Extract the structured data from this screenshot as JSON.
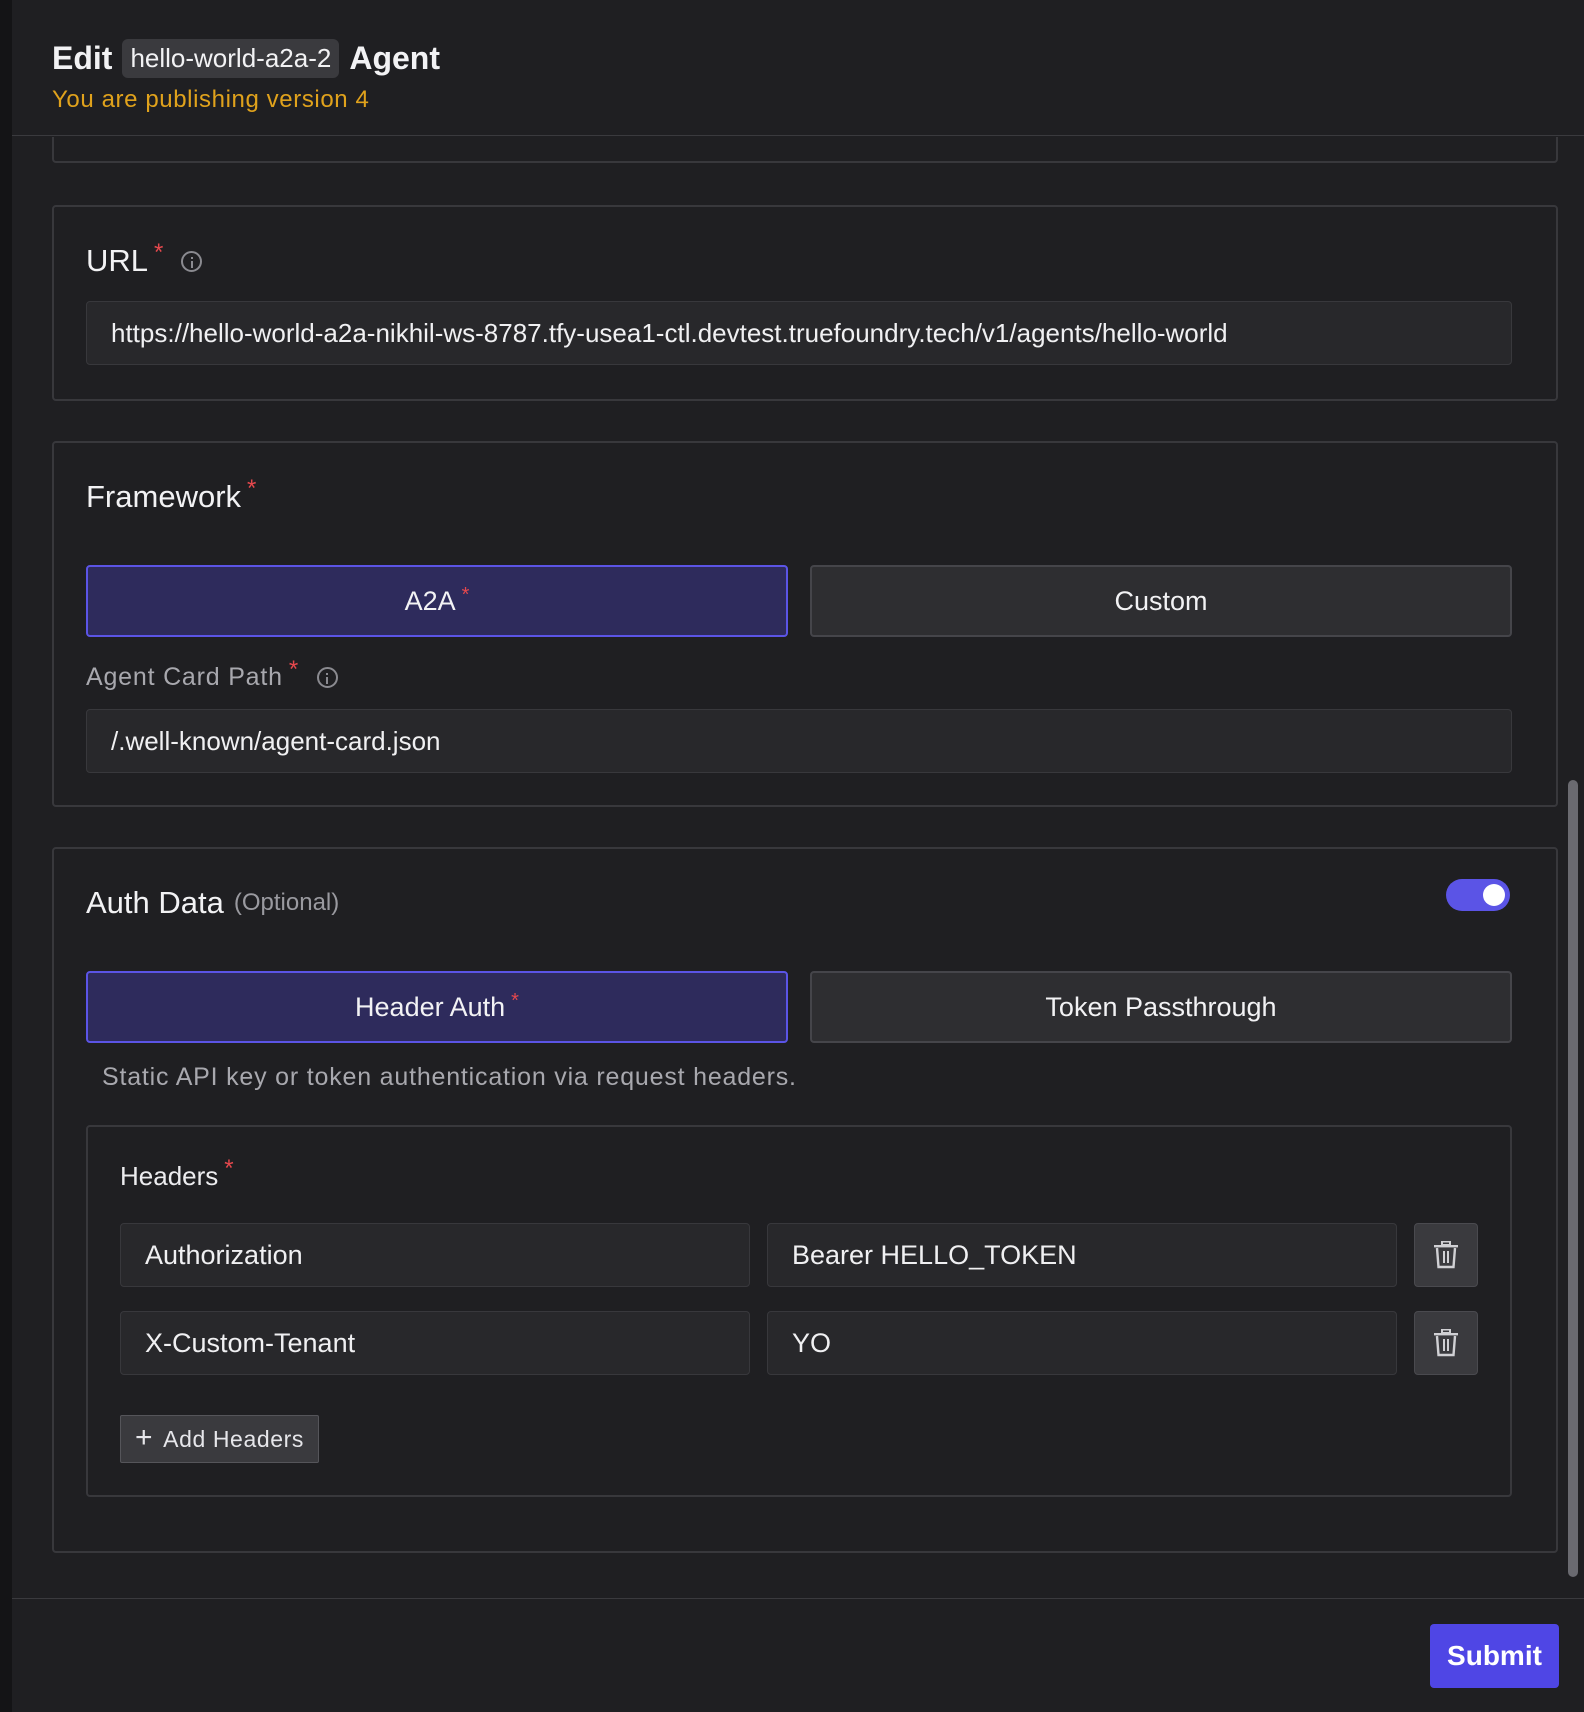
{
  "header": {
    "title_prefix": "Edit",
    "agent_name": "hello-world-a2a-2",
    "title_suffix": "Agent",
    "subtitle": "You are publishing version 4"
  },
  "url_section": {
    "label": "URL",
    "required_mark": "*",
    "value": "https://hello-world-a2a-nikhil-ws-8787.tfy-usea1-ctl.devtest.truefoundry.tech/v1/agents/hello-world"
  },
  "framework_section": {
    "label": "Framework",
    "required_mark": "*",
    "options": [
      {
        "label": "A2A",
        "selected": true,
        "required_mark": "*"
      },
      {
        "label": "Custom",
        "selected": false
      }
    ],
    "agent_card_path_label": "Agent Card Path",
    "agent_card_path_value": "/.well-known/agent-card.json"
  },
  "auth_section": {
    "label": "Auth Data",
    "optional_text": "(Optional)",
    "enabled": true,
    "options": [
      {
        "label": "Header Auth",
        "selected": true,
        "required_mark": "*"
      },
      {
        "label": "Token Passthrough",
        "selected": false
      }
    ],
    "helper_text": "Static API key or token authentication via request headers.",
    "headers_label": "Headers",
    "headers": [
      {
        "key": "Authorization",
        "value": "Bearer HELLO_TOKEN"
      },
      {
        "key": "X-Custom-Tenant",
        "value": "YO"
      }
    ],
    "add_button_label": "Add Headers"
  },
  "footer": {
    "submit_label": "Submit"
  },
  "colors": {
    "accent": "#4f46e5",
    "warning_text": "#e0a21c",
    "required": "#e5484d"
  }
}
